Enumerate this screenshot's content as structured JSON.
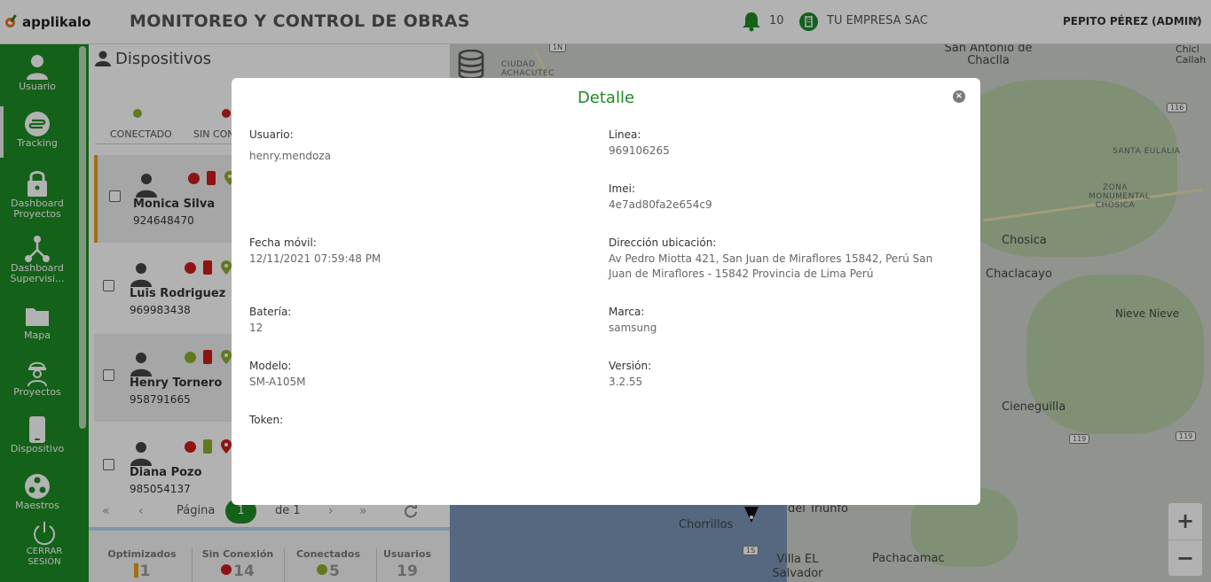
{
  "header": {
    "brand": "applikalo",
    "title": "MONITOREO Y CONTROL DE OBRAS",
    "notifications_count": "10",
    "company": "TU EMPRESA SAC",
    "user": "PEPITO PÉREZ (ADMIN)"
  },
  "sidebar": {
    "items": [
      {
        "label": "Usuario"
      },
      {
        "label": "Tracking"
      },
      {
        "label": "Dashboard Proyectos"
      },
      {
        "label": "Dashboard Supervisi..."
      },
      {
        "label": "Mapa"
      },
      {
        "label": "Proyectos"
      },
      {
        "label": "Dispositivo"
      },
      {
        "label": "Maestros"
      },
      {
        "label": "CERRAR SESIÓN"
      }
    ]
  },
  "devices_panel": {
    "title": "Dispositivos",
    "legend": {
      "connected": "CONECTADO",
      "disconnected": "SIN CON"
    },
    "devices": [
      {
        "name": "Monica Silva",
        "phone": "924648470"
      },
      {
        "name": "Luis Rodriguez",
        "phone": "969983438"
      },
      {
        "name": "Henry Tornero",
        "phone": "958791665"
      },
      {
        "name": "Diana Pozo",
        "phone": "985054137"
      }
    ],
    "pager": {
      "page_label": "Página",
      "current": "1",
      "of_label": "de 1"
    },
    "stats": [
      {
        "label": "Optimizados",
        "value": "1"
      },
      {
        "label": "Sin Conexión",
        "value": "14"
      },
      {
        "label": "Conectados",
        "value": "5"
      },
      {
        "label": "Usuarios",
        "value": "19"
      }
    ]
  },
  "map": {
    "labels": {
      "san_antonio": "San Antonio de Chaclla",
      "chosica": "Chosica",
      "chaclacayo": "Chaclacayo",
      "nieve_nieve": "Nieve Nieve",
      "cieneguilla": "Cieneguilla",
      "chorrillos": "Chorrillos",
      "del_triunfo": "del Triunfo",
      "villa_el_salvador": "Villa EL Salvador",
      "pachacamac": "Pachacamac",
      "ciudad_achacutec": "CIUDAD ACHACUTEC",
      "santa_eulalia": "SANTA EULALIA",
      "zona_monumental": "ZONA MONUMENTAL CHOSICA",
      "callahuanca": "Chicl Callah"
    },
    "shields": {
      "s1": "1N",
      "s2": "116",
      "s3": "119",
      "s4": "119",
      "s5": "1S"
    },
    "zoom_in": "+",
    "zoom_out": "−"
  },
  "modal": {
    "title": "Detalle",
    "close": "×",
    "fields": {
      "usuario": {
        "label": "Usuario:",
        "value": "henry.mendoza"
      },
      "linea": {
        "label": "Linea:",
        "value": "969106265"
      },
      "imei": {
        "label": "Imei:",
        "value": "4e7ad80fa2e654c9"
      },
      "fecha": {
        "label": "Fecha móvil:",
        "value": "12/11/2021 07:59:48 PM"
      },
      "direccion": {
        "label": "Dirección ubicación:",
        "value": "Av Pedro Miotta 421, San Juan de Miraflores 15842, Perú San Juan de Miraflores - 15842 Provincia de Lima Perú"
      },
      "bateria": {
        "label": "Batería:",
        "value": "12"
      },
      "marca": {
        "label": "Marca:",
        "value": "samsung"
      },
      "modelo": {
        "label": "Modelo:",
        "value": "SM-A105M"
      },
      "version": {
        "label": "Versión:",
        "value": "3.2.55"
      },
      "token": {
        "label": "Token:",
        "value": ""
      }
    }
  },
  "colors": {
    "brand_green": "#1d8b25",
    "status_green": "#8dae2b",
    "status_red": "#cc1d1d",
    "highlight_orange": "#e6a11a"
  }
}
